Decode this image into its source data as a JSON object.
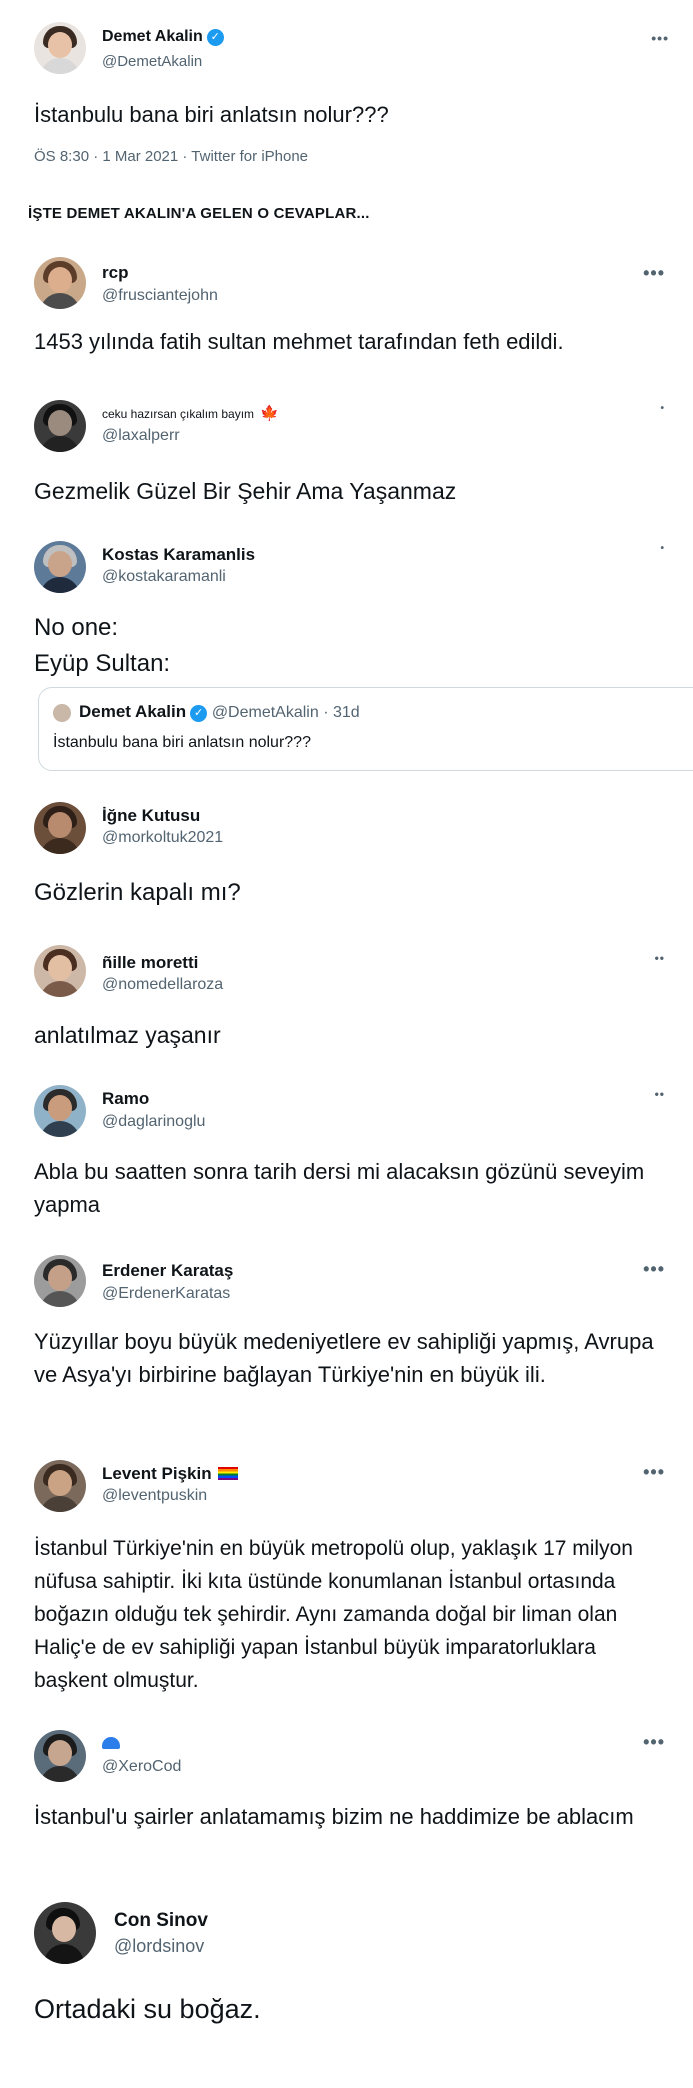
{
  "colors": {
    "link_blue": "#1d9bf0",
    "secondary_text": "#536471",
    "verified": "#1d9bf0"
  },
  "main_tweet": {
    "name": "Demet Akalin",
    "handle": "@DemetAkalin",
    "text": "İstanbulu bana biri anlatsın nolur???",
    "meta": "ÖS 8:30 · 1 Mar 2021 · Twitter for iPhone",
    "more": "•••"
  },
  "heading": "İŞTE DEMET AKALIN'A GELEN O CEVAPLAR...",
  "replies": [
    {
      "name": "rcp",
      "handle": "@fruscianteјohn",
      "text": "1453 yılında fatih sultan mehmet tarafından feth edildi.",
      "more": "•••"
    },
    {
      "name": "ceku hazırsan çıkalım bayım",
      "handle": "@laxalperr",
      "text": "Gezmelik Güzel Bir Şehir Ama Yaşanmaz",
      "more": "•"
    },
    {
      "name": "Kostas Karamanlis",
      "handle": "@kostakaramanli",
      "text_line1": "No one:",
      "text_line2": "Eyüp Sultan:",
      "more": "•",
      "quote": {
        "name": "Demet Akalin",
        "handle": "@DemetAkalin · 31d",
        "text": "İstanbulu bana biri anlatsın nolur???"
      }
    },
    {
      "name": "İğne Kutusu",
      "handle": "@morkoltuk2021",
      "text": "Gözlerin kapalı mı?"
    },
    {
      "name": "ñille moretti",
      "handle": "@nomedellaroza",
      "text": "anlatılmaz yaşanır",
      "more": "••"
    },
    {
      "name": "Ramo",
      "handle": "@daglarinoglu",
      "text": "Abla bu saatten sonra tarih dersi mi alacaksın gözünü seveyim yapma",
      "more": "••"
    },
    {
      "name": "Erdener Karataş",
      "handle": "@ErdenerKaratas",
      "text": "Yüzyıllar boyu büyük medeniyetlere ev sahipliği yapmış, Avrupa ve Asya'yı birbirine bağlayan Türkiye'nin en büyük ili.",
      "more": "•••"
    },
    {
      "name": "Levent Pişkin",
      "handle": "@leventpuskin",
      "text": "İstanbul Türkiye'nin en büyük metropolü olup, yaklaşık 17 milyon nüfusa sahiptir. İki kıta üstünde konumlanan İstanbul ortasında boğazın olduğu tek şehirdir. Aynı zamanda doğal bir liman olan Haliç'e de ev sahipliği yapan İstanbul büyük imparatorluklara başkent olmuştur.",
      "more": "•••"
    },
    {
      "name": "",
      "handle": "@XeroCod",
      "text": "İstanbul'u şairler anlatamamış bizim ne haddimize be ablacım",
      "more": "•••"
    },
    {
      "name": "Con Sinov",
      "handle": "@lordsinov",
      "text": "Ortadaki su boğaz."
    }
  ]
}
